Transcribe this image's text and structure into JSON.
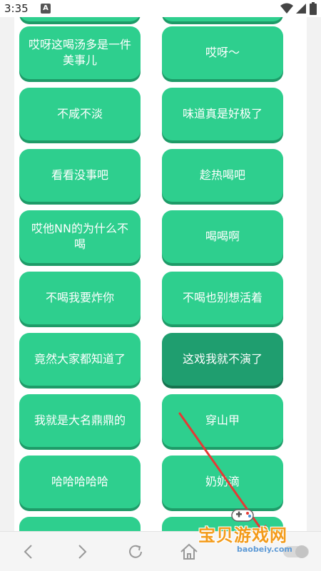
{
  "status_bar": {
    "time": "3:35",
    "notification_icon_letter": "A",
    "wifi_icon": "wifi-icon",
    "signal_icon": "signal-icon",
    "battery_icon": "battery-icon"
  },
  "buttons": [
    {
      "label": ""
    },
    {
      "label": ""
    },
    {
      "label": "哎呀这喝汤多是一件美事儿"
    },
    {
      "label": "哎呀～"
    },
    {
      "label": "不咸不淡"
    },
    {
      "label": "味道真是好极了"
    },
    {
      "label": "看看没事吧"
    },
    {
      "label": "趁热喝吧"
    },
    {
      "label": "哎他NN的为什么不喝"
    },
    {
      "label": "喝喝啊"
    },
    {
      "label": "不喝我要炸你"
    },
    {
      "label": "不喝也别想活着"
    },
    {
      "label": "竟然大家都知道了"
    },
    {
      "label": "这戏我就不演了"
    },
    {
      "label": "我就是大名鼎鼎的"
    },
    {
      "label": "穿山甲"
    },
    {
      "label": "哈哈哈哈哈"
    },
    {
      "label": "奶奶滴"
    },
    {
      "label": ""
    },
    {
      "label": ""
    }
  ],
  "nav_bar": {
    "icons": [
      "back-icon",
      "forward-icon",
      "refresh-icon",
      "home-icon",
      "toggle-icon"
    ]
  },
  "watermark": {
    "text": "宝贝游戏网",
    "url": "baobeiy.com"
  },
  "colors": {
    "button": "#2ecf8e",
    "button_active": "#1f9e6f",
    "arrow": "#e53935"
  }
}
